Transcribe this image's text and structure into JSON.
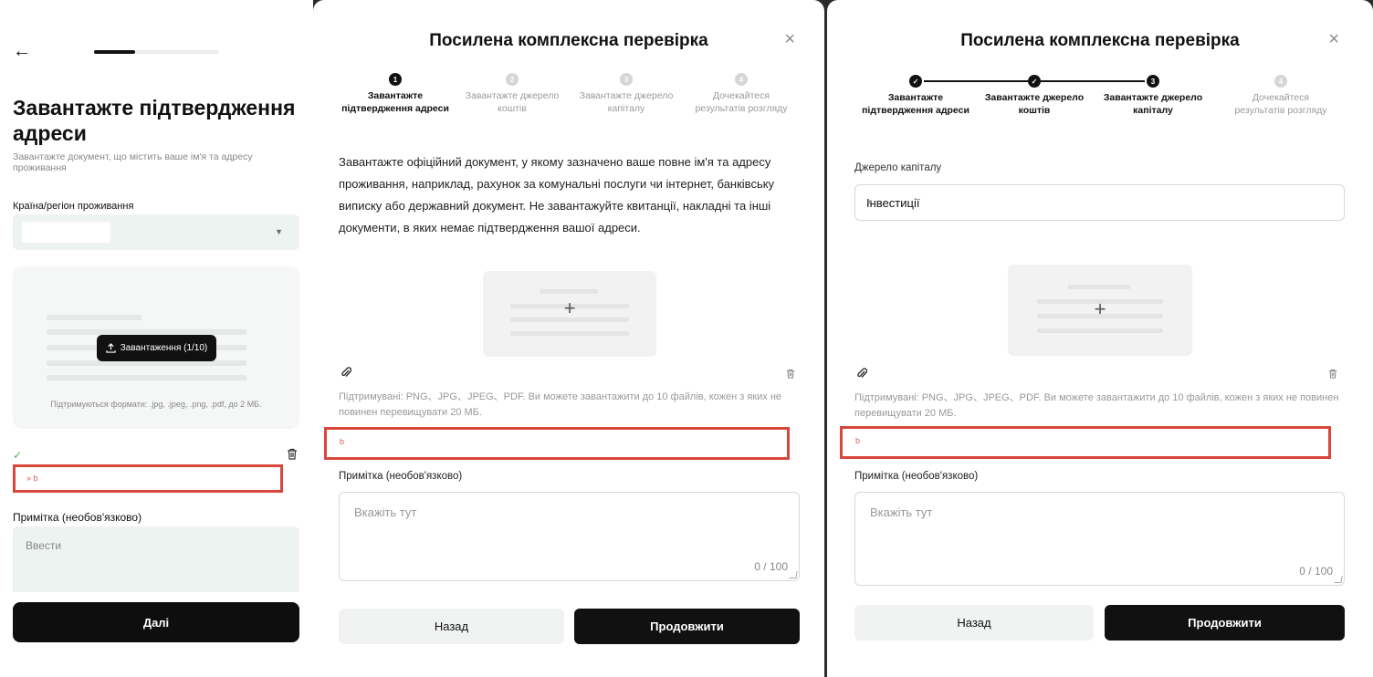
{
  "screen1": {
    "back_arrow": "←",
    "progress": 0.33,
    "title": "Завантажте підтвердження адреси",
    "subtitle": "Завантажте документ, що містить ваше ім'я та адресу проживання",
    "country_label": "Країна/регіон проживання",
    "country_value": "",
    "upload_button": "Завантаження (1/10)",
    "formats_hint": "Підтримуються формати: .jpg, .jpeg, .png, .pdf, до 2 МБ.",
    "file_name": "» b",
    "note_label": "Примітка (необов'язково)",
    "note_placeholder": "Ввести",
    "next_button": "Далі"
  },
  "screen2": {
    "title": "Посилена комплексна перевірка",
    "close": "×",
    "steps": [
      {
        "num": "1",
        "label": "Завантажте підтвердження адреси",
        "state": "active"
      },
      {
        "num": "2",
        "label": "Завантажте джерело коштів",
        "state": "pending"
      },
      {
        "num": "3",
        "label": "Завантажте джерело капіталу",
        "state": "pending"
      },
      {
        "num": "4",
        "label": "Дочекайтеся результатів розгляду",
        "state": "pending"
      }
    ],
    "description": "Завантажте офіційний документ, у якому зазначено ваше повне ім'я та адресу проживання, наприклад, рахунок за комунальні послуги чи інтернет, банківську виписку або державний документ. Не завантажуйте квитанції, накладні та інші документи, в яких немає підтвердження вашої адреси.",
    "plus": "+",
    "supported": "Підтримувані: PNG、JPG、JPEG、PDF. Ви можете завантажити до 10 файлів, кожен з яких не повинен перевищувати 20 МБ.",
    "file_name": "b",
    "note_label": "Примітка (необов'язково)",
    "note_placeholder": "Вкажіть тут",
    "counter": "0 / 100",
    "back_button": "Назад",
    "continue_button": "Продовжити"
  },
  "screen3": {
    "title": "Посилена комплексна перевірка",
    "close": "×",
    "steps": [
      {
        "num": "✓",
        "label": "Завантажте підтвердження адреси",
        "state": "done"
      },
      {
        "num": "✓",
        "label": "Завантажте джерело коштів",
        "state": "done"
      },
      {
        "num": "3",
        "label": "Завантажте джерело капіталу",
        "state": "active"
      },
      {
        "num": "4",
        "label": "Дочекайтеся результатів розгляду",
        "state": "pending"
      }
    ],
    "source_label": "Джерело капіталу",
    "source_value": "Інвестиції",
    "plus": "+",
    "supported": "Підтримувані: PNG、JPG、JPEG、PDF. Ви можете завантажити до 10 файлів, кожен з яких не повинен перевищувати 20 МБ.",
    "file_name": "b",
    "note_label": "Примітка (необов'язково)",
    "note_placeholder": "Вкажіть тут",
    "counter": "0 / 100",
    "back_button": "Назад",
    "continue_button": "Продовжити"
  }
}
